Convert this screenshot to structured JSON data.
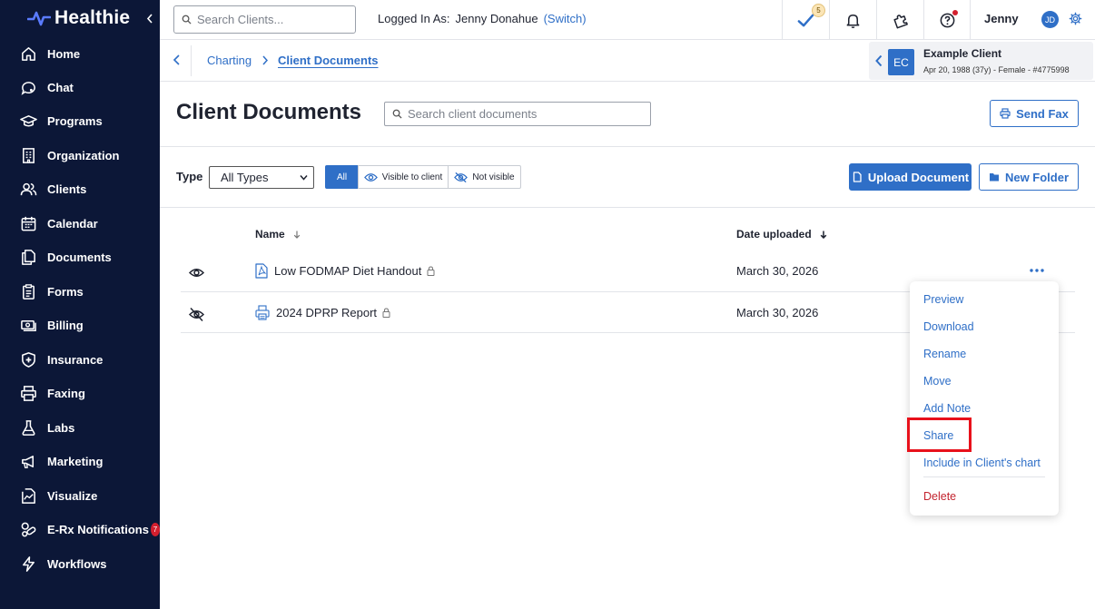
{
  "app": {
    "name": "Healthie"
  },
  "sidebar": {
    "items": [
      {
        "label": "Home",
        "icon": "home-icon"
      },
      {
        "label": "Chat",
        "icon": "chat-icon"
      },
      {
        "label": "Programs",
        "icon": "graduation-cap-icon"
      },
      {
        "label": "Organization",
        "icon": "building-icon"
      },
      {
        "label": "Clients",
        "icon": "users-icon"
      },
      {
        "label": "Calendar",
        "icon": "calendar-icon"
      },
      {
        "label": "Documents",
        "icon": "documents-icon"
      },
      {
        "label": "Forms",
        "icon": "clipboard-icon"
      },
      {
        "label": "Billing",
        "icon": "money-icon"
      },
      {
        "label": "Insurance",
        "icon": "shield-icon"
      },
      {
        "label": "Faxing",
        "icon": "printer-icon"
      },
      {
        "label": "Labs",
        "icon": "flask-icon"
      },
      {
        "label": "Marketing",
        "icon": "megaphone-icon"
      },
      {
        "label": "Visualize",
        "icon": "chart-icon"
      },
      {
        "label": "E-Rx Notifications",
        "icon": "pills-icon",
        "badge": "7"
      },
      {
        "label": "Workflows",
        "icon": "bolt-icon"
      }
    ]
  },
  "topbar": {
    "search_placeholder": "Search Clients...",
    "logged_in_label": "Logged In As:",
    "logged_in_user": "Jenny Donahue",
    "switch_label": "(Switch)",
    "tasks_badge": "5",
    "user_first_name": "Jenny",
    "user_initials": "JD"
  },
  "breadcrumb": {
    "items": [
      "Charting",
      "Client Documents"
    ]
  },
  "client": {
    "initials": "EC",
    "name": "Example Client",
    "meta": "Apr 20, 1988 (37y) - Female - #4775998"
  },
  "page": {
    "title": "Client Documents",
    "search_placeholder": "Search client documents",
    "send_fax_label": "Send Fax",
    "upload_label": "Upload Document",
    "new_folder_label": "New Folder"
  },
  "filters": {
    "type_label": "Type",
    "type_value": "All Types",
    "visibility": [
      "All",
      "Visible to client",
      "Not visible"
    ],
    "active_visibility": "All"
  },
  "table": {
    "columns": [
      "Name",
      "Date uploaded"
    ],
    "rows": [
      {
        "name": "Low FODMAP Diet Handout",
        "date": "March 30, 2026",
        "visible": true,
        "file_type": "pdf"
      },
      {
        "name": "2024 DPRP Report",
        "date": "March 30, 2026",
        "visible": false,
        "file_type": "fax"
      }
    ]
  },
  "menu": {
    "items": [
      "Preview",
      "Download",
      "Rename",
      "Move",
      "Add Note",
      "Share",
      "Include in Client's chart"
    ],
    "danger_item": "Delete",
    "highlighted": "Share"
  },
  "colors": {
    "sidebar_bg": "#0c1737",
    "accent": "#2f6fc7",
    "danger": "#c3242f",
    "highlight": "#e8111b"
  }
}
